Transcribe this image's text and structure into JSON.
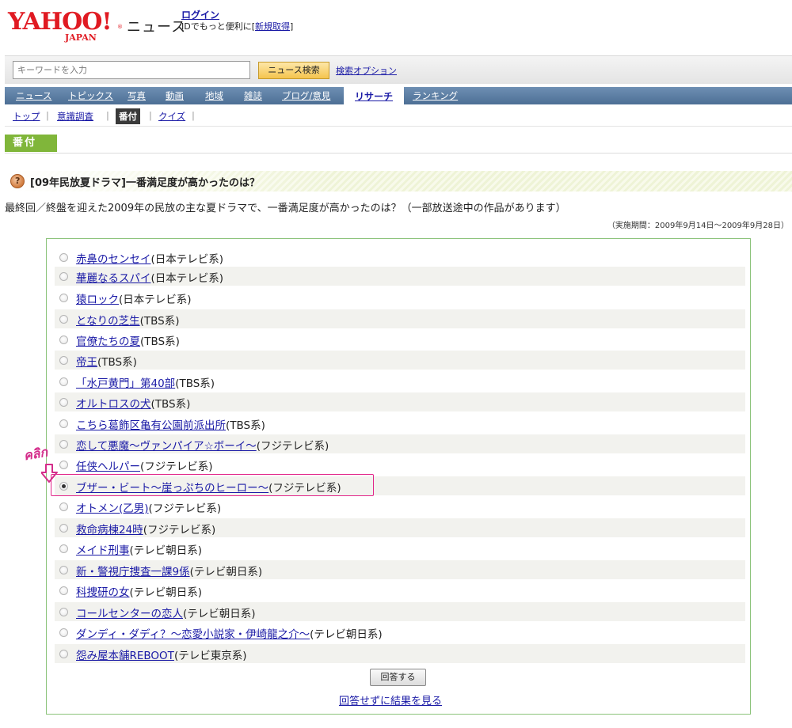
{
  "header": {
    "logo_main": "YAHOO!",
    "logo_sub": "JAPAN",
    "logo_reg": "®",
    "service": "ニュース",
    "login_link": "ログイン",
    "login_note_prefix": "IDでもっと便利に[",
    "register_link": "新規取得",
    "login_note_suffix": "]"
  },
  "search": {
    "placeholder": "キーワードを入力",
    "button": "ニュース検索",
    "options_link": "検索オプション"
  },
  "main_nav": {
    "items": [
      "ニュース",
      "トピックス",
      "写真",
      "動画",
      "地域",
      "雑誌",
      "ブログ/意見"
    ],
    "active": "リサーチ",
    "after": "ランキング"
  },
  "sub_nav": {
    "top": "トップ",
    "opinion": "意識調査",
    "current": "番付",
    "quiz": "クイズ",
    "sep": "|"
  },
  "section": {
    "title": "番付"
  },
  "question": {
    "title": "[09年民放夏ドラマ]一番満足度が高かったのは？",
    "description": "最終回／終盤を迎えた2009年の民放の主な夏ドラマで、一番満足度が高かったのは？（一部放送途中の作品があります）",
    "period": "（実施期間：2009年9月14日～2009年9月28日）"
  },
  "options": [
    {
      "title": "赤鼻のセンセイ",
      "network": "(日本テレビ系)",
      "checked": false
    },
    {
      "title": "華麗なるスパイ",
      "network": "(日本テレビ系)",
      "checked": false
    },
    {
      "title": "猿ロック",
      "network": "(日本テレビ系)",
      "checked": false
    },
    {
      "title": "となりの芝生",
      "network": "(TBS系)",
      "checked": false
    },
    {
      "title": "官僚たちの夏",
      "network": "(TBS系)",
      "checked": false
    },
    {
      "title": "帝王",
      "network": "(TBS系)",
      "checked": false
    },
    {
      "title": "「水戸黄門」第40部",
      "network": "(TBS系)",
      "checked": false
    },
    {
      "title": "オルトロスの犬",
      "network": "(TBS系)",
      "checked": false
    },
    {
      "title": "こちら葛飾区亀有公園前派出所",
      "network": "(TBS系)",
      "checked": false
    },
    {
      "title": "恋して悪魔～ヴァンパイア☆ボーイ～",
      "network": "(フジテレビ系)",
      "checked": false
    },
    {
      "title": "任侠ヘルパー",
      "network": "(フジテレビ系)",
      "checked": false
    },
    {
      "title": "ブザー・ビート～崖っぷちのヒーロー～",
      "network": "(フジテレビ系)",
      "checked": true
    },
    {
      "title": "オトメン(乙男)",
      "network": "(フジテレビ系)",
      "checked": false
    },
    {
      "title": "救命病棟24時",
      "network": "(フジテレビ系)",
      "checked": false
    },
    {
      "title": "メイド刑事",
      "network": "(テレビ朝日系)",
      "checked": false
    },
    {
      "title": "新・警視庁捜査一課9係",
      "network": "(テレビ朝日系)",
      "checked": false
    },
    {
      "title": "科捜研の女",
      "network": "(テレビ朝日系)",
      "checked": false
    },
    {
      "title": "コールセンターの恋人",
      "network": "(テレビ朝日系)",
      "checked": false
    },
    {
      "title": "ダンディ・ダディ？～恋愛小説家・伊崎龍之介～",
      "network": "(テレビ朝日系)",
      "checked": false
    },
    {
      "title": "怨み屋本舗REBOOT",
      "network": "(テレビ東京系)",
      "checked": false
    }
  ],
  "annotation": {
    "text": "คลิก"
  },
  "actions": {
    "submit": "回答する",
    "results_link": "回答せずに結果を見る"
  },
  "colors": {
    "nav_bg": "#5a7ca3",
    "section_tab": "#80b63a",
    "poll_border": "#8bc37a",
    "highlight": "#e2268a",
    "link": "#1a1aa6"
  }
}
